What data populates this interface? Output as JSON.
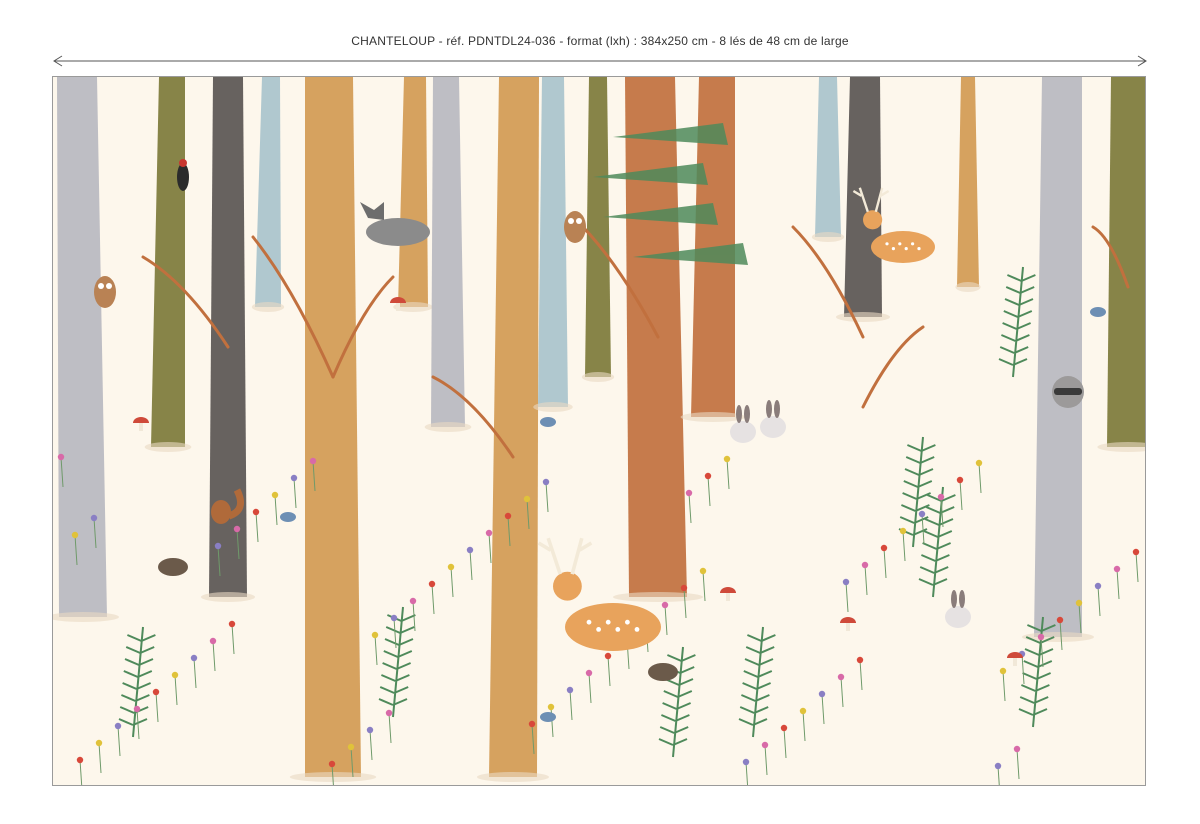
{
  "caption": "CHANTELOUP - réf. PDNTDL24-036 - format (lxh) : 384x250 cm - 8 lés de 48 cm de large",
  "colors": {
    "background": "#fdf7ec",
    "birch": "#b9b8c0",
    "bluegrey": "#a9c3cc",
    "ochre": "#d39a52",
    "rust": "#c1703e",
    "olive": "#7d7a3a",
    "dark": "#5a5552",
    "fern": "#4f8a5b",
    "pink": "#d86aa8",
    "violet": "#8a7fc4"
  },
  "icons": [
    "deer-icon",
    "wolf-icon",
    "owl-icon",
    "woodpecker-icon",
    "rabbit-icon",
    "raccoon-icon",
    "hedgehog-icon",
    "squirrel-icon",
    "mushroom-icon",
    "fern-icon",
    "bird-icon"
  ]
}
